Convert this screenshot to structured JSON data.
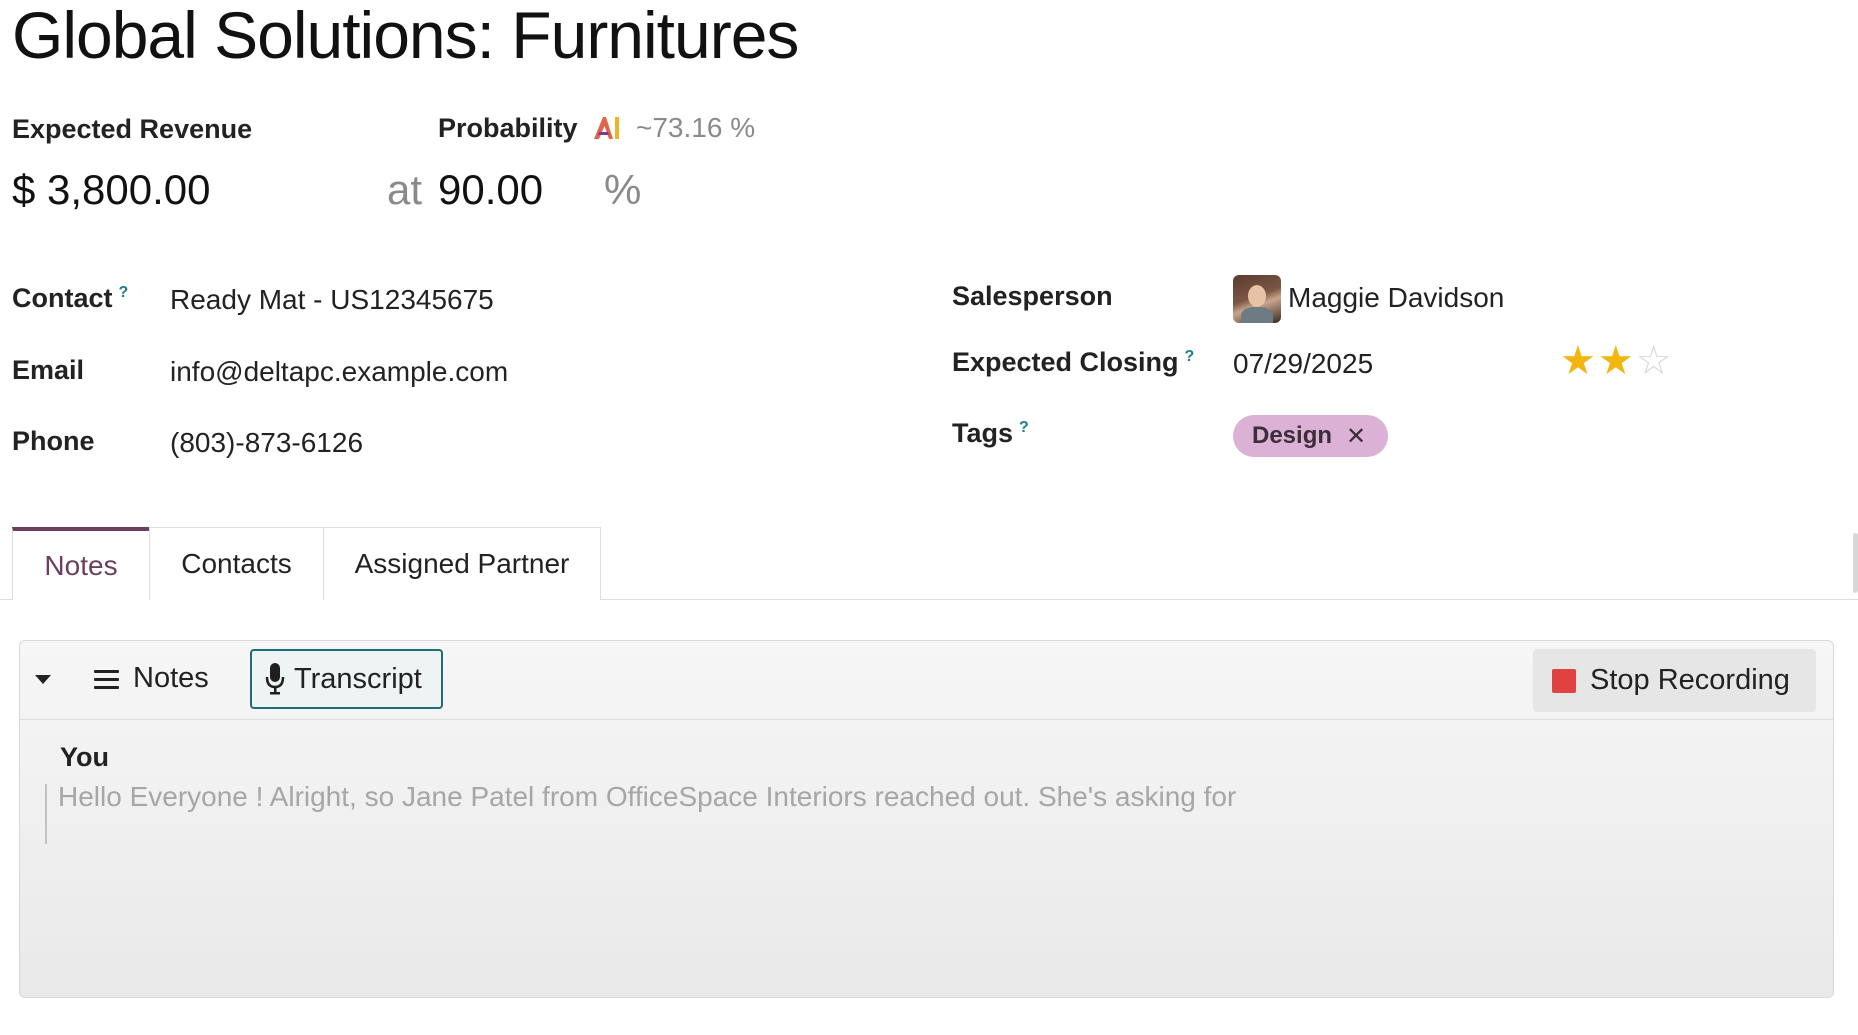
{
  "record": {
    "title": "Global Solutions: Furnitures",
    "expected_revenue_label": "Expected Revenue",
    "expected_revenue_value": "$ 3,800.00",
    "at_label": "at",
    "probability_label": "Probability",
    "ai_estimate": "~73.16 %",
    "probability_value": "90.00",
    "percent_sign": "%"
  },
  "left_fields": {
    "contact_label": "Contact",
    "contact_value": "Ready Mat - US12345675",
    "email_label": "Email",
    "email_value": "info@deltapc.example.com",
    "phone_label": "Phone",
    "phone_value": "(803)-873-6126"
  },
  "right_fields": {
    "salesperson_label": "Salesperson",
    "salesperson_value": "Maggie Davidson",
    "expected_closing_label": "Expected Closing",
    "expected_closing_value": "07/29/2025",
    "priority_stars": 2,
    "priority_max": 3,
    "tags_label": "Tags",
    "tags": [
      "Design"
    ]
  },
  "help_marker": "?",
  "tabs": [
    {
      "label": "Notes",
      "active": true
    },
    {
      "label": "Contacts",
      "active": false
    },
    {
      "label": "Assigned Partner",
      "active": false
    }
  ],
  "notes_panel": {
    "notes_label": "Notes",
    "transcript_label": "Transcript",
    "stop_recording_label": "Stop Recording",
    "speaker": "You",
    "transcript_text": "Hello Everyone ! Alright, so Jane Patel from OfficeSpace Interiors reached out. She's asking for"
  },
  "icons": {
    "ai": "ai-sparkle-icon",
    "star_on": "★",
    "star_off": "☆",
    "tag_remove": "✕",
    "hamburger": "hamburger-icon",
    "mic": "microphone-icon",
    "stop": "stop-square-icon",
    "caret": "caret-down-icon"
  },
  "colors": {
    "accent": "#6b3f5d",
    "tag_bg": "#dcb1d6",
    "star": "#f3b50f",
    "help": "#1a7f8e",
    "stop": "#e04242",
    "transcript_border": "#1e6f74"
  }
}
